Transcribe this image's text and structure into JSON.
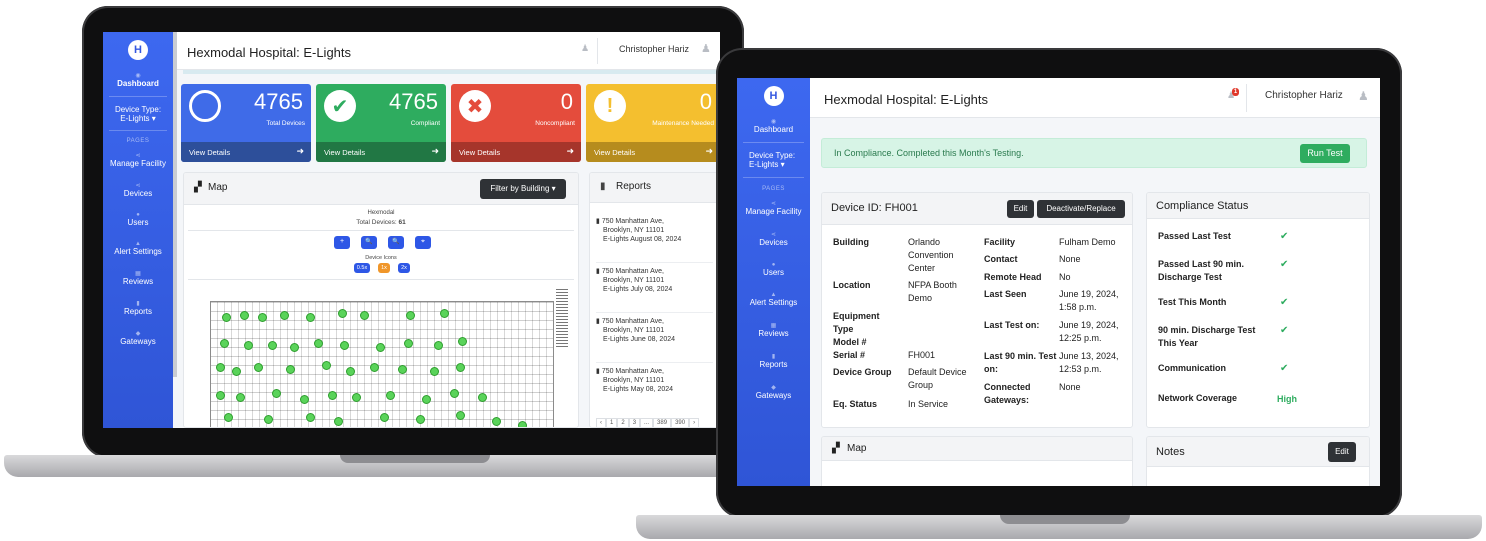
{
  "app_title": "Hexmodal Hospital: E-Lights",
  "user_name": "Christopher Hariz",
  "logo_letter": "H",
  "sidebar": {
    "dashboard": "Dashboard",
    "device_type_label": "Device Type:",
    "device_type_value": "E-Lights ▾",
    "pages_label": "PAGES",
    "items": [
      "Manage Facility",
      "Devices",
      "Users",
      "Alert Settings",
      "Reviews",
      "Reports",
      "Gateways"
    ]
  },
  "dashboard": {
    "stats": [
      {
        "value": "4765",
        "label": "Total Devices",
        "footer": "View Details",
        "color": "#3f6be8",
        "footer_color": "#2d4f9a"
      },
      {
        "value": "4765",
        "label": "Compliant",
        "footer": "View Details",
        "color": "#2eac5f",
        "footer_color": "#217744"
      },
      {
        "value": "0",
        "label": "Noncompliant",
        "footer": "View Details",
        "color": "#e44c3c",
        "footer_color": "#a6352b"
      },
      {
        "value": "0",
        "label": "Maintenance Needed",
        "footer": "View Details",
        "color": "#f4bf2f",
        "footer_color": "#b68c1e"
      }
    ],
    "map": {
      "title": "Map",
      "filter_button": "Filter by Building ▾",
      "facility_name": "Hexmodal",
      "total_devices_label": "Total Devices:",
      "total_devices_value": "61",
      "device_icons_label": "Device Icons",
      "zoom_buttons": [
        "+",
        "🔍",
        "🔍",
        "⌖"
      ],
      "scale_options": [
        "0.5x",
        "1x",
        "2x"
      ]
    },
    "reports": {
      "title": "Reports",
      "items": [
        {
          "address1": "750 Manhattan Ave,",
          "address2": "Brooklyn, NY 11101",
          "label": "E-Lights August 08, 2024"
        },
        {
          "address1": "750 Manhattan Ave,",
          "address2": "Brooklyn, NY 11101",
          "label": "E-Lights July 08, 2024"
        },
        {
          "address1": "750 Manhattan Ave,",
          "address2": "Brooklyn, NY 11101",
          "label": "E-Lights June 08, 2024"
        },
        {
          "address1": "750 Manhattan Ave,",
          "address2": "Brooklyn, NY 11101",
          "label": "E-Lights May 08, 2024"
        }
      ],
      "pagination": [
        "‹",
        "1",
        "2",
        "3",
        "...",
        "389",
        "390",
        "›"
      ]
    }
  },
  "device": {
    "alert_text": "In Compliance. Completed this Month's Testing.",
    "run_test": "Run Test",
    "notification_count": "1",
    "device_id": "Device ID: FH001",
    "edit": "Edit",
    "deactivate": "Deactivate/Replace",
    "left_fields": [
      {
        "label": "Building",
        "value": "Orlando Convention Center"
      },
      {
        "label": "Location",
        "value": "NFPA Booth Demo"
      },
      {
        "label": "Equipment Type",
        "value": ""
      },
      {
        "label": "Model #",
        "value": ""
      },
      {
        "label": "Serial #",
        "value": "FH001"
      },
      {
        "label": "Device Group",
        "value": "Default Device Group"
      },
      {
        "label": "Eq. Status",
        "value": "In Service"
      }
    ],
    "right_fields": [
      {
        "label": "Facility",
        "value": "Fulham Demo"
      },
      {
        "label": "Contact",
        "value": "None"
      },
      {
        "label": "Remote Head",
        "value": "No"
      },
      {
        "label": "Last Seen",
        "value": "June 19, 2024, 1:58 p.m."
      },
      {
        "label": "Last Test on:",
        "value": "June 19, 2024, 12:25 p.m."
      },
      {
        "label": "Last 90 min. Test on:",
        "value": "June 13, 2024, 12:53 p.m."
      },
      {
        "label": "Connected Gateways:",
        "value": "None"
      }
    ],
    "compliance": {
      "title": "Compliance Status",
      "items": [
        {
          "label": "Passed Last Test",
          "value": "✔"
        },
        {
          "label": "Passed Last 90 min. Discharge Test",
          "value": "✔"
        },
        {
          "label": "Test This Month",
          "value": "✔"
        },
        {
          "label": "90 min. Discharge Test This Year",
          "value": "✔"
        },
        {
          "label": "Communication",
          "value": "✔"
        },
        {
          "label": "Network Coverage",
          "value": "High"
        }
      ]
    },
    "map_title": "Map",
    "notes_title": "Notes",
    "notes_edit": "Edit"
  }
}
